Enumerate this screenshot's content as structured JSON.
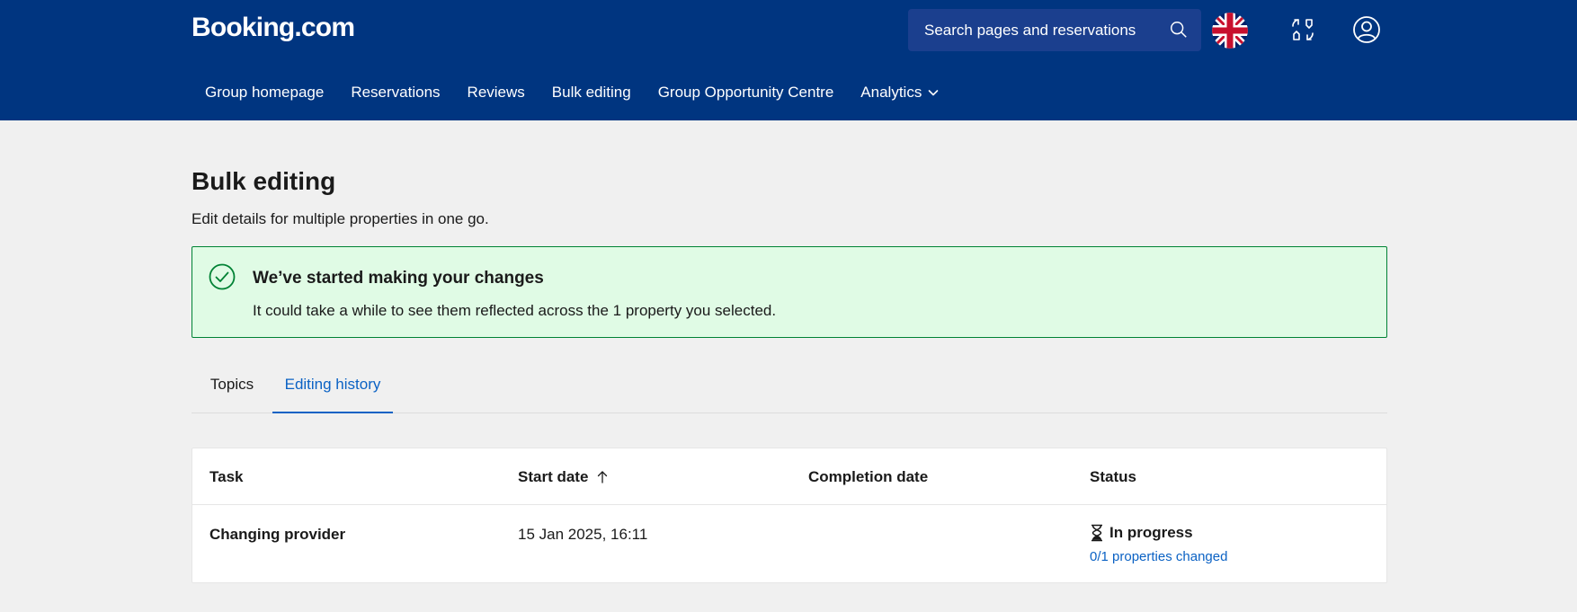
{
  "header": {
    "logo": "Booking.com",
    "search_text": "Search pages and reservations",
    "nav": [
      {
        "label": "Group homepage"
      },
      {
        "label": "Reservations"
      },
      {
        "label": "Reviews"
      },
      {
        "label": "Bulk editing"
      },
      {
        "label": "Group Opportunity Centre"
      },
      {
        "label": "Analytics"
      }
    ]
  },
  "main": {
    "title": "Bulk editing",
    "subtitle": "Edit details for multiple properties in one go.",
    "banner": {
      "title": "We’ve started making your changes",
      "text": "It could take a while to see them reflected across the 1 property you selected."
    },
    "tabs": [
      {
        "label": "Topics"
      },
      {
        "label": "Editing history"
      }
    ],
    "table": {
      "headers": [
        "Task",
        "Start date",
        "Completion date",
        "Status"
      ],
      "rows": [
        {
          "task": "Changing provider",
          "start_date": "15 Jan 2025, 16:11",
          "completion_date": "",
          "status": "In progress",
          "status_link": "0/1 properties changed"
        }
      ]
    }
  },
  "colors": {
    "header_bg": "#003580",
    "accent": "#0b62c4",
    "success_bg": "#e0fbe5",
    "success_border": "#008234"
  },
  "icons": [
    "search-icon",
    "uk-flag-icon",
    "switch-property-icon",
    "account-icon",
    "chevron-down-icon",
    "check-circle-icon",
    "sort-ascending-icon",
    "hourglass-icon"
  ]
}
